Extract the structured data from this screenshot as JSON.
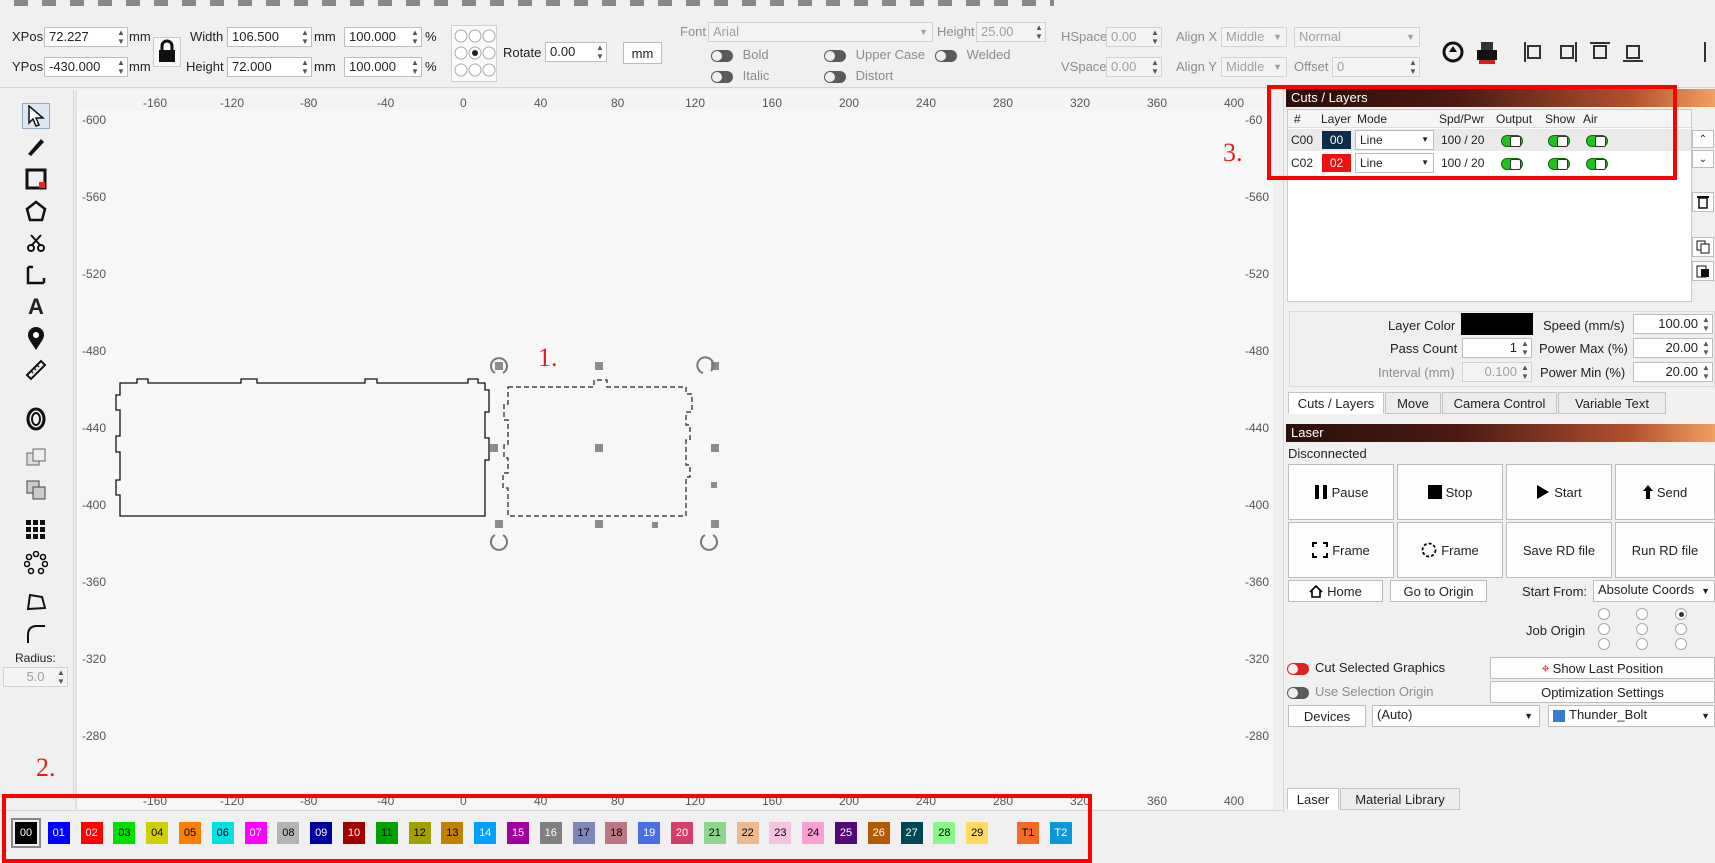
{
  "toolbar": {
    "xpos_label": "XPos",
    "xpos": "72.227",
    "ypos_label": "YPos",
    "ypos": "-430.000",
    "mm": "mm",
    "pct": "%",
    "width_label": "Width",
    "width": "106.500",
    "height_label": "Height",
    "height": "72.000",
    "scale_w": "100.000",
    "scale_h": "100.000",
    "rotate_label": "Rotate",
    "rotate": "0.00",
    "unit_button": "mm",
    "font_label": "Font",
    "font": "Arial",
    "font_height_label": "Height",
    "font_height": "25.00",
    "bold": "Bold",
    "italic": "Italic",
    "upper_case": "Upper Case",
    "distort": "Distort",
    "welded": "Welded",
    "hspace_label": "HSpace",
    "hspace": "0.00",
    "vspace_label": "VSpace",
    "vspace": "0.00",
    "alignx_label": "Align X",
    "alignx": "Middle",
    "aligny_label": "Align Y",
    "aligny": "Middle",
    "normal": "Normal",
    "offset_label": "Offset",
    "offset": "0"
  },
  "left_tools": {
    "radius_label": "Radius:",
    "radius": "5.0"
  },
  "ruler": {
    "top": [
      "-160",
      "-120",
      "-80",
      "-40",
      "0",
      "40",
      "80",
      "120",
      "160",
      "200",
      "240",
      "280",
      "320",
      "360",
      "400"
    ],
    "side": [
      "-600",
      "-560",
      "-520",
      "-480",
      "-440",
      "-400",
      "-360",
      "-320",
      "-280"
    ],
    "right_side": [
      "-60",
      "-560",
      "-520",
      "-480",
      "-440",
      "-400",
      "-360",
      "-320",
      "-280"
    ],
    "bottom": [
      "-160",
      "-120",
      "-80",
      "-40",
      "0",
      "40",
      "80",
      "120",
      "160",
      "200",
      "240",
      "280",
      "320",
      "360",
      "400"
    ]
  },
  "annotations": [
    "1.",
    "2.",
    "3."
  ],
  "cuts_layers": {
    "title": "Cuts / Layers",
    "headers": [
      "#",
      "Layer",
      "Mode",
      "Spd/Pwr",
      "Output",
      "Show",
      "Air"
    ],
    "rows": [
      {
        "id": "C00",
        "layer": "00",
        "color": "#0d2b4a",
        "mode": "Line",
        "spdpwr": "100 / 20"
      },
      {
        "id": "C02",
        "layer": "02",
        "color": "#ee1111",
        "mode": "Line",
        "spdpwr": "100 / 20"
      }
    ]
  },
  "layer_settings": {
    "layer_color_label": "Layer Color",
    "speed_label": "Speed (mm/s)",
    "speed": "100.00",
    "pass_count_label": "Pass Count",
    "pass_count": "1",
    "power_max_label": "Power Max (%)",
    "power_max": "20.00",
    "interval_label": "Interval (mm)",
    "interval": "0.100",
    "power_min_label": "Power Min (%)",
    "power_min": "20.00"
  },
  "right_tabs": [
    "Cuts / Layers",
    "Move",
    "Camera Control",
    "Variable Text"
  ],
  "laser": {
    "title": "Laser",
    "status": "Disconnected",
    "pause": "Pause",
    "stop": "Stop",
    "start": "Start",
    "send": "Send",
    "frame1": "Frame",
    "frame2": "Frame",
    "save_rd": "Save RD file",
    "run_rd": "Run RD file",
    "home": "Home",
    "go_origin": "Go to Origin",
    "start_from_label": "Start From:",
    "start_from": "Absolute Coords",
    "job_origin_label": "Job Origin",
    "cut_selected": "Cut Selected Graphics",
    "use_selection": "Use Selection Origin",
    "show_last": "Show Last Position",
    "optimization": "Optimization Settings",
    "devices": "Devices",
    "auto": "(Auto)",
    "device": "Thunder_Bolt"
  },
  "bottom_tabs": [
    "Laser",
    "Material Library"
  ],
  "palette": [
    {
      "label": "00",
      "color": "#000000",
      "text": "#ffffff"
    },
    {
      "label": "01",
      "color": "#0000ff",
      "text": "#ffffff"
    },
    {
      "label": "02",
      "color": "#ff0000",
      "text": "#ffffff"
    },
    {
      "label": "03",
      "color": "#00e000",
      "text": "#000000"
    },
    {
      "label": "04",
      "color": "#d0d000",
      "text": "#000000"
    },
    {
      "label": "05",
      "color": "#ff8000",
      "text": "#000000"
    },
    {
      "label": "06",
      "color": "#00e0e0",
      "text": "#000000"
    },
    {
      "label": "07",
      "color": "#ff00ff",
      "text": "#ffffff"
    },
    {
      "label": "08",
      "color": "#b4b4b4",
      "text": "#000000"
    },
    {
      "label": "09",
      "color": "#0000a0",
      "text": "#ffffff"
    },
    {
      "label": "10",
      "color": "#a00000",
      "text": "#ffffff"
    },
    {
      "label": "11",
      "color": "#00a000",
      "text": "#000000"
    },
    {
      "label": "12",
      "color": "#a0a000",
      "text": "#000000"
    },
    {
      "label": "13",
      "color": "#c08000",
      "text": "#000000"
    },
    {
      "label": "14",
      "color": "#00a0ff",
      "text": "#ffffff"
    },
    {
      "label": "15",
      "color": "#a000a0",
      "text": "#ffffff"
    },
    {
      "label": "16",
      "color": "#808080",
      "text": "#ffffff"
    },
    {
      "label": "17",
      "color": "#7d87b9",
      "text": "#000000"
    },
    {
      "label": "18",
      "color": "#bb7784",
      "text": "#000000"
    },
    {
      "label": "19",
      "color": "#4a6fe3",
      "text": "#ffffff"
    },
    {
      "label": "20",
      "color": "#d33f6a",
      "text": "#ffffff"
    },
    {
      "label": "21",
      "color": "#8cd78c",
      "text": "#000000"
    },
    {
      "label": "22",
      "color": "#f0b98d",
      "text": "#000000"
    },
    {
      "label": "23",
      "color": "#f6c4e1",
      "text": "#000000"
    },
    {
      "label": "24",
      "color": "#fa9ed4",
      "text": "#000000"
    },
    {
      "label": "25",
      "color": "#500a78",
      "text": "#ffffff"
    },
    {
      "label": "26",
      "color": "#b45a00",
      "text": "#ffffff"
    },
    {
      "label": "27",
      "color": "#004754",
      "text": "#ffffff"
    },
    {
      "label": "28",
      "color": "#86fa88",
      "text": "#000000"
    },
    {
      "label": "29",
      "color": "#ffdb66",
      "text": "#000000"
    },
    {
      "label": "T1",
      "color": "#f36926",
      "text": "#000000"
    },
    {
      "label": "T2",
      "color": "#0c98d8",
      "text": "#ffffff"
    }
  ]
}
